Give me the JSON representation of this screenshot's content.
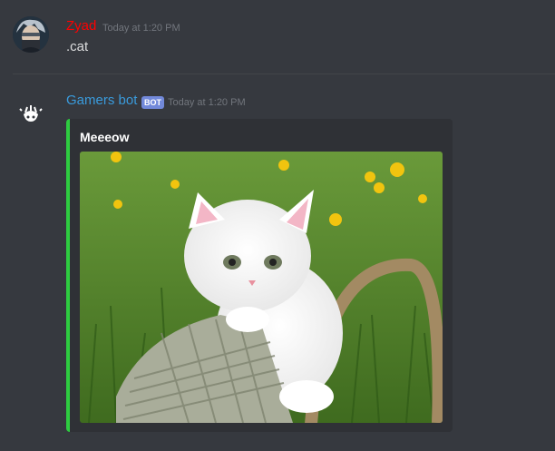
{
  "messages": [
    {
      "author": "Zyad",
      "author_color": "#ff0000",
      "timestamp": "Today at 1:20 PM",
      "content": ".cat"
    },
    {
      "author": "Gamers bot",
      "author_color": "#3a9bdc",
      "bot_tag": "BOT",
      "timestamp": "Today at 1:20 PM",
      "embed": {
        "title": "Meeeow",
        "accent_color": "#2ecc40",
        "image": "white kitten in wicker basket on grass"
      }
    }
  ]
}
